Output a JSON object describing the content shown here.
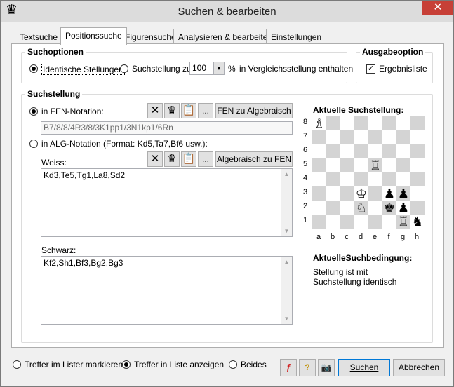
{
  "window": {
    "title": "Suchen & bearbeiten",
    "close": "✕",
    "app_icon": "♛"
  },
  "tabs": [
    {
      "label": "Textsuche"
    },
    {
      "label": "Positionssuche",
      "active": true
    },
    {
      "label": "Figurensuche"
    },
    {
      "label": "Analysieren & bearbeiten"
    },
    {
      "label": "Einstellungen"
    }
  ],
  "suchoptionen": {
    "title": "Suchoptionen",
    "identisch_label": "Identische Stellungen",
    "suchstellung_label": "Suchstellung zu",
    "percent_value": "100",
    "percent_suffix": "%",
    "enthalten_label": "in Vergleichsstellung enthalten"
  },
  "ausgabeoption": {
    "title": "Ausgabeoption",
    "ergebnisliste_label": "Ergebnisliste",
    "ergebnisliste_checked": true
  },
  "suchstellung": {
    "title": "Suchstellung",
    "fen_label": "in FEN-Notation:",
    "fen_value": "B7/8/8/4R3/8/3K1pp1/3N1kp1/6Rn",
    "fen_to_alg_button": "FEN zu Algebraisch",
    "alg_label": "in ALG-Notation (Format: Kd5,Ta7,Bf6 usw.):",
    "alg_to_fen_button": "Algebraisch zu FEN",
    "weiss_label": "Weiss:",
    "weiss_value": "Kd3,Te5,Tg1,La8,Sd2",
    "schwarz_label": "Schwarz:",
    "schwarz_value": "Kf2,Sh1,Bf3,Bg2,Bg3",
    "more_button": "..."
  },
  "board": {
    "title": "Aktuelle Suchstellung:",
    "ranks": [
      "8",
      "7",
      "6",
      "5",
      "4",
      "3",
      "2",
      "1"
    ],
    "files": [
      "a",
      "b",
      "c",
      "d",
      "e",
      "f",
      "g",
      "h"
    ],
    "pieces": [
      {
        "sq": "a8",
        "glyph": "♗"
      },
      {
        "sq": "e5",
        "glyph": "♖"
      },
      {
        "sq": "d3",
        "glyph": "♔"
      },
      {
        "sq": "f3",
        "glyph": "♟"
      },
      {
        "sq": "g3",
        "glyph": "♟"
      },
      {
        "sq": "d2",
        "glyph": "♘"
      },
      {
        "sq": "f2",
        "glyph": "♚"
      },
      {
        "sq": "g2",
        "glyph": "♟"
      },
      {
        "sq": "g1",
        "glyph": "♖"
      },
      {
        "sq": "h1",
        "glyph": "♞"
      }
    ]
  },
  "bedingung": {
    "title": "AktuelleSuchbedingung:",
    "text": "Stellung ist mit Suchstellung identisch"
  },
  "bottom": {
    "markieren_label": "Treffer im Lister markieren",
    "anzeigen_label": "Treffer in Liste anzeigen",
    "beides_label": "Beides",
    "suchen_button": "Suchen",
    "abbrechen_button": "Abbrechen"
  }
}
